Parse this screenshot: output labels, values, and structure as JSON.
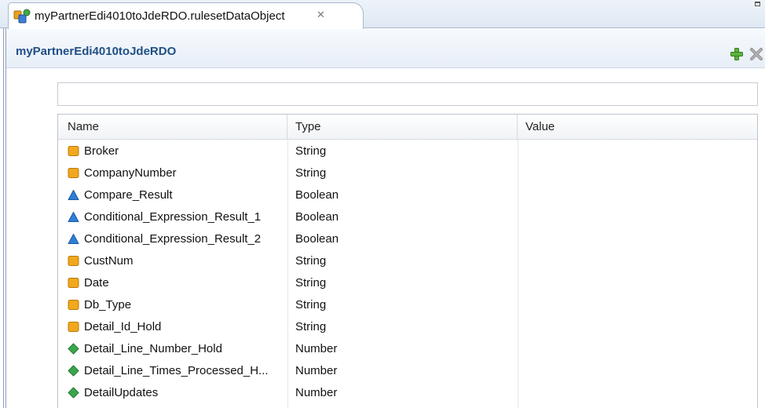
{
  "editor_tab": {
    "title": "myPartnerEdi4010toJdeRDO.rulesetDataObject",
    "icon": "ruleset-data-object-icon",
    "close_glyph": "✕"
  },
  "section": {
    "title": "myPartnerEdi4010toJdeRDO",
    "add_icon": "add-plus-icon",
    "delete_icon": "delete-x-icon"
  },
  "filter": {
    "value": ""
  },
  "table": {
    "columns": [
      "Name",
      "Type",
      "Value"
    ],
    "rows": [
      {
        "name": "Broker",
        "type": "String",
        "value": "",
        "icon": "string-icon"
      },
      {
        "name": "CompanyNumber",
        "type": "String",
        "value": "",
        "icon": "string-icon"
      },
      {
        "name": "Compare_Result",
        "type": "Boolean",
        "value": "",
        "icon": "boolean-icon"
      },
      {
        "name": "Conditional_Expression_Result_1",
        "type": "Boolean",
        "value": "",
        "icon": "boolean-icon"
      },
      {
        "name": "Conditional_Expression_Result_2",
        "type": "Boolean",
        "value": "",
        "icon": "boolean-icon"
      },
      {
        "name": "CustNum",
        "type": "String",
        "value": "",
        "icon": "string-icon"
      },
      {
        "name": "Date",
        "type": "String",
        "value": "",
        "icon": "string-icon"
      },
      {
        "name": "Db_Type",
        "type": "String",
        "value": "",
        "icon": "string-icon"
      },
      {
        "name": "Detail_Id_Hold",
        "type": "String",
        "value": "",
        "icon": "string-icon"
      },
      {
        "name": "Detail_Line_Number_Hold",
        "type": "Number",
        "value": "",
        "icon": "number-icon"
      },
      {
        "name": "Detail_Line_Times_Processed_H...",
        "type": "Number",
        "value": "",
        "icon": "number-icon"
      },
      {
        "name": "DetailUpdates",
        "type": "Number",
        "value": "",
        "icon": "number-icon"
      }
    ]
  },
  "colors": {
    "string_icon": "#f2a81d",
    "boolean_icon": "#2f7fd6",
    "number_icon": "#3aa64c",
    "section_title": "#1f4f86",
    "add_icon": "#4aa52e",
    "delete_icon": "#8c8c8c"
  }
}
